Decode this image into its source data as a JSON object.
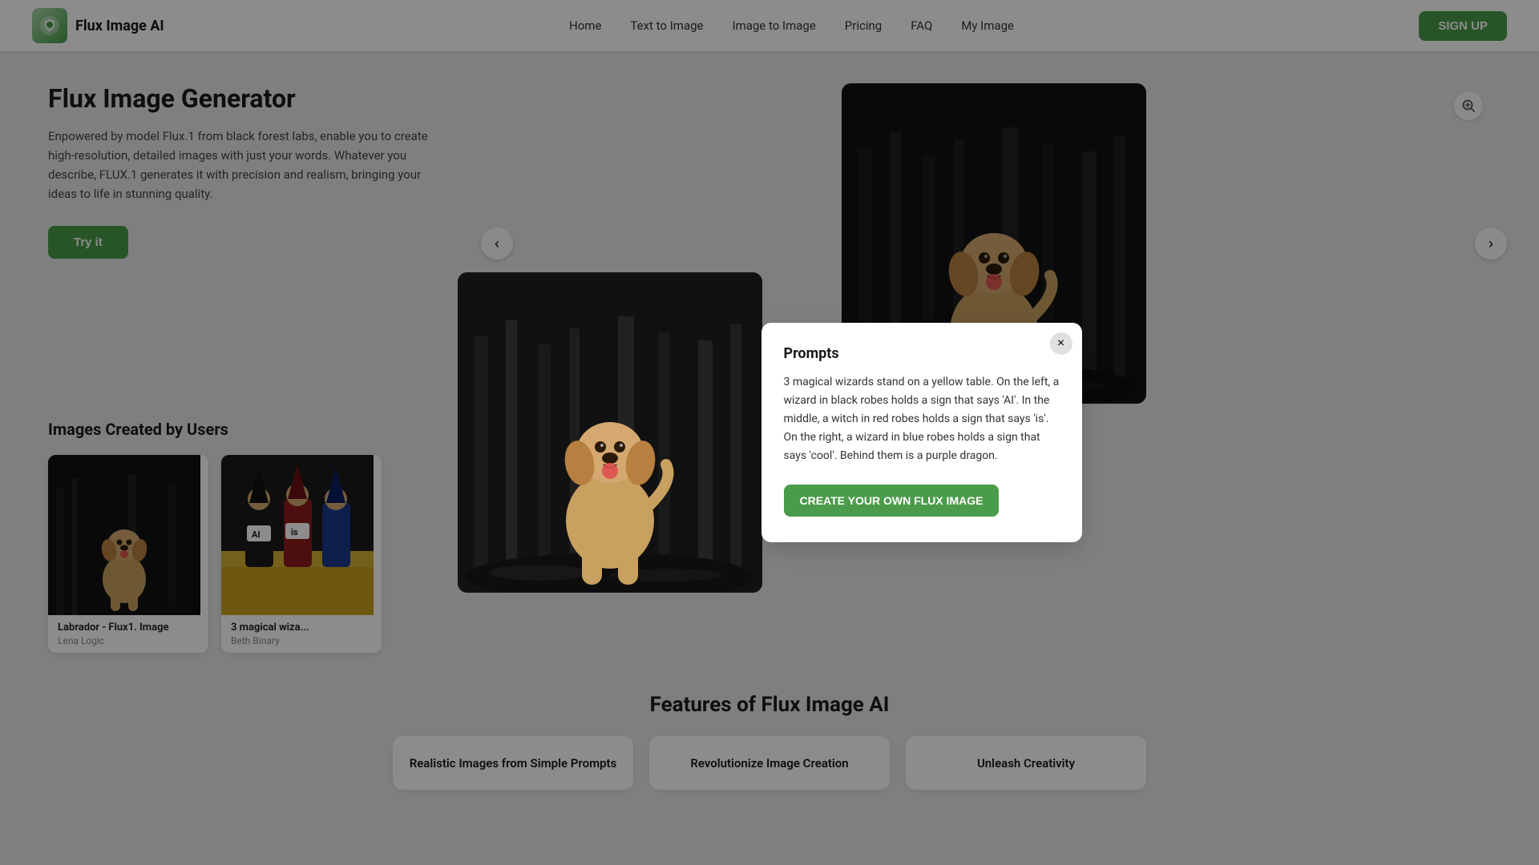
{
  "brand": {
    "name": "Flux Image AI",
    "logo_alt": "flux.ai logo"
  },
  "nav": {
    "home": "Home",
    "text_to_image": "Text to Image",
    "image_to_image": "Image to Image",
    "pricing": "Pricing",
    "faq": "FAQ",
    "my_image": "My Image",
    "signup": "SIGN UP"
  },
  "hero": {
    "title": "Flux Image Generator",
    "description": "Enpowered by model Flux.1 from black forest labs, enable you to create high-resolution, detailed images with just your words. Whatever you describe, FLUX.1 generates it with precision and realism, bringing your ideas to life in stunning quality.",
    "try_button": "Try it"
  },
  "images_section": {
    "title": "Images Created by Users"
  },
  "gallery": [
    {
      "name": "Labrador - Flux1. Image",
      "author": "Lena Logic"
    },
    {
      "name": "3 magical wiza...",
      "author": "Beth Binary"
    }
  ],
  "features": {
    "title": "Features of Flux Image AI",
    "items": [
      {
        "label": "Realistic Images from Simple Prompts"
      },
      {
        "label": "Revolutionize Image Creation"
      },
      {
        "label": "Unleash Creativity"
      }
    ]
  },
  "modal": {
    "title": "Prompts",
    "prompt_text": "3 magical wizards stand on a yellow table. On the left, a wizard in black robes holds a sign that says 'AI'. In the middle, a witch in red robes holds a sign that says 'is'. On the right, a wizard in blue robes holds a sign that says 'cool'. Behind them is a purple dragon.",
    "cta": "CREATE YOUR OWN FLUX IMAGE",
    "close_label": "×"
  },
  "zoom_icon": "zoom-icon",
  "carousel": {
    "prev": "‹",
    "next": "›"
  }
}
